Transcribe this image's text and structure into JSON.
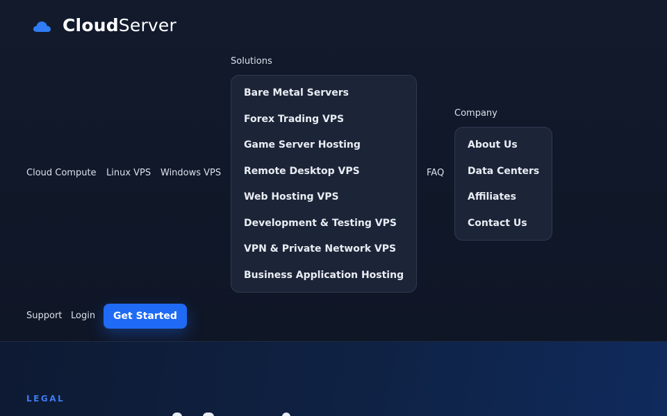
{
  "brand": {
    "name_bold": "Cloud",
    "name_rest": "Server",
    "icon": "cloud-icon",
    "accent": "#2f7cf6"
  },
  "nav": {
    "cloud_compute": "Cloud Compute",
    "linux_vps": "Linux VPS",
    "windows_vps": "Windows VPS",
    "solutions": {
      "label": "Solutions",
      "items": [
        "Bare Metal Servers",
        "Forex Trading VPS",
        "Game Server Hosting",
        "Remote Desktop VPS",
        "Web Hosting VPS",
        "Development & Testing VPS",
        "VPN & Private Network VPS",
        "Business Application Hosting"
      ]
    },
    "faq": "FAQ",
    "company": {
      "label": "Company",
      "items": [
        "About Us",
        "Data Centers",
        "Affiliates",
        "Contact Us"
      ]
    },
    "support": "Support",
    "login": "Login",
    "cta": "Get Started"
  },
  "hero": {
    "eyebrow": "LEGAL"
  },
  "colors": {
    "background": "#0f1626",
    "dropdown_bg": "#1c2537",
    "cta_bg": "#1f6bf5",
    "eyebrow": "#3f7bf2"
  }
}
